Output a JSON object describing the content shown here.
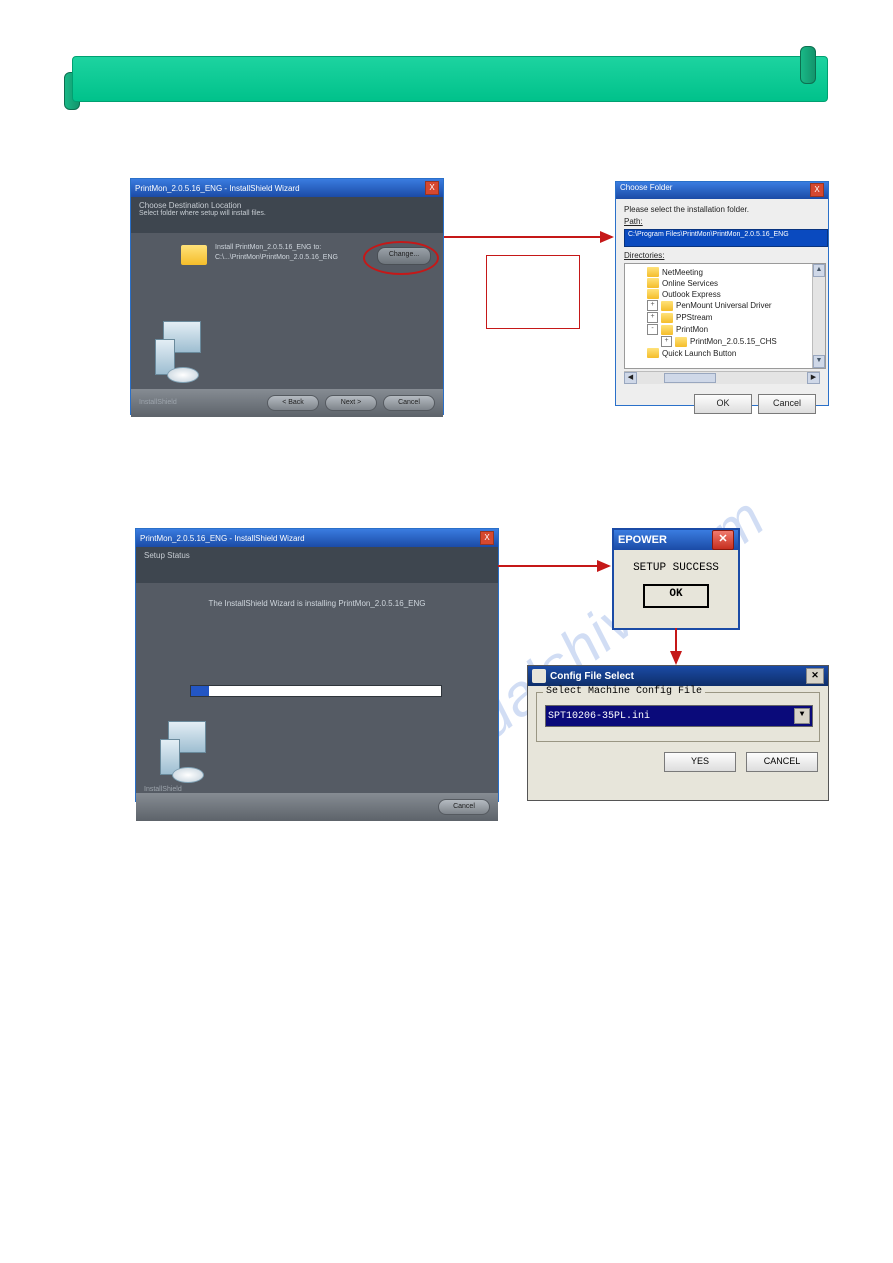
{
  "watermark": "manualshive.com",
  "installer1": {
    "title": "PrintMon_2.0.5.16_ENG - InstallShield Wizard",
    "header_title": "Choose Destination Location",
    "header_sub": "Select folder where setup will install files.",
    "folder_line1": "Install PrintMon_2.0.5.16_ENG to:",
    "folder_line2": "C:\\...\\PrintMon\\PrintMon_2.0.5.16_ENG",
    "change": "Change...",
    "back": "< Back",
    "next": "Next >",
    "cancel": "Cancel",
    "brand": "InstallShield"
  },
  "browse": {
    "title": "Choose Folder",
    "close": "X",
    "prompt": "Please select the installation folder.",
    "path_label": "Path:",
    "path_value": "C:\\Program Files\\PrintMon\\PrintMon_2.0.5.16_ENG",
    "dir_label": "Directories:",
    "items": {
      "0": "NetMeeting",
      "1": "Online Services",
      "2": "Outlook Express",
      "3": "PenMount Universal Driver",
      "4": "PPStream",
      "5": "PrintMon",
      "6": "PrintMon_2.0.5.15_CHS",
      "7": "Quick Launch Button"
    },
    "ok": "OK",
    "cancel": "Cancel"
  },
  "installer2": {
    "title": "PrintMon_2.0.5.16_ENG - InstallShield Wizard",
    "header_title": "Setup Status",
    "body_msg": "The InstallShield Wizard is installing PrintMon_2.0.5.16_ENG",
    "cancel": "Cancel",
    "brand": "InstallShield"
  },
  "epower": {
    "title": "EPOWER",
    "msg": "SETUP SUCCESS",
    "ok": "OK"
  },
  "config": {
    "title": "Config File Select",
    "legend": "Select Machine Config File",
    "value": "SPT10206-35PL.ini",
    "yes": "YES",
    "cancel": "CANCEL"
  }
}
